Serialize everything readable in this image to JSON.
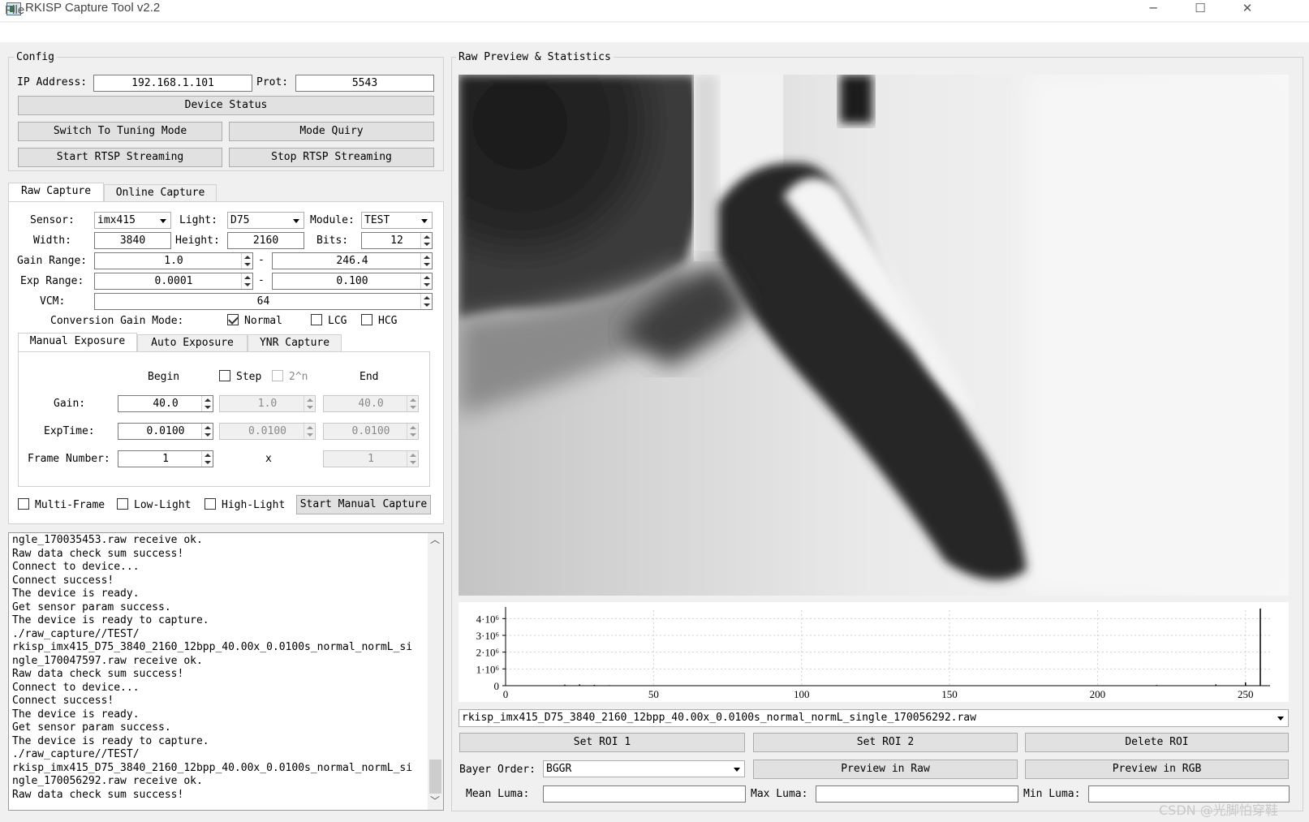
{
  "window": {
    "title": "RKISP Capture Tool v2.2",
    "minimize": "─",
    "maximize": "☐",
    "close": "✕"
  },
  "menu": {
    "file": "File"
  },
  "config": {
    "title": "Config",
    "ip_label": "IP Address:",
    "ip_value": "192.168.1.101",
    "port_label": "Prot:",
    "port_value": "5543",
    "device_status": "Device Status",
    "switch_tuning": "Switch To Tuning Mode",
    "mode_query": "Mode Quiry",
    "start_rtsp": "Start RTSP Streaming",
    "stop_rtsp": "Stop RTSP Streaming"
  },
  "capture_tabs": [
    "Raw Capture",
    "Online Capture"
  ],
  "raw": {
    "sensor_label": "Sensor:",
    "sensor_value": "imx415",
    "light_label": "Light:",
    "light_value": "D75",
    "module_label": "Module:",
    "module_value": "TEST",
    "width_label": "Width:",
    "width_value": "3840",
    "height_label": "Height:",
    "height_value": "2160",
    "bits_label": "Bits:",
    "bits_value": "12",
    "gain_range_label": "Gain Range:",
    "gain_min": "1.0",
    "gain_max": "246.4",
    "exp_range_label": "Exp Range:",
    "exp_min": "0.0001",
    "exp_max": "0.100",
    "dash": "-",
    "vcm_label": "VCM:",
    "vcm_value": "64",
    "cg_mode_label": "Conversion Gain Mode:",
    "cg_normal": "Normal",
    "cg_normal_checked": true,
    "cg_lcg": "LCG",
    "cg_hcg": "HCG"
  },
  "exposure_tabs": [
    "Manual Exposure",
    "Auto Exposure",
    "YNR Capture"
  ],
  "manual": {
    "begin": "Begin",
    "step": "Step",
    "pow2": "2^n",
    "end": "End",
    "gain_label": "Gain:",
    "gain_begin": "40.0",
    "gain_step": "1.0",
    "gain_end": "40.0",
    "exptime_label": "ExpTime:",
    "exp_begin": "0.0100",
    "exp_step": "0.0100",
    "exp_end": "0.0100",
    "frame_label": "Frame Number:",
    "frame_begin": "1",
    "x": "x",
    "frame_end": "1"
  },
  "options": {
    "multi_frame": "Multi-Frame",
    "low_light": "Low-Light",
    "high_light": "High-Light",
    "start_manual": "Start Manual Capture"
  },
  "log_lines": [
    "ngle_170035453.raw receive ok.",
    "Raw data check sum success!",
    "Connect to device...",
    "Connect success!",
    "The device is ready.",
    "Get sensor param success.",
    "The device is ready to capture.",
    "./raw_capture//TEST/",
    "rkisp_imx415_D75_3840_2160_12bpp_40.00x_0.0100s_normal_normL_si",
    "ngle_170047597.raw receive ok.",
    "Raw data check sum success!",
    "Connect to device...",
    "Connect success!",
    "The device is ready.",
    "Get sensor param success.",
    "The device is ready to capture.",
    "./raw_capture//TEST/",
    "rkisp_imx415_D75_3840_2160_12bpp_40.00x_0.0100s_normal_normL_si",
    "ngle_170056292.raw receive ok.",
    "Raw data check sum success!"
  ],
  "preview": {
    "title": "Raw Preview & Statistics",
    "file_value": "rkisp_imx415_D75_3840_2160_12bpp_40.00x_0.0100s_normal_normL_single_170056292.raw",
    "set_roi1": "Set ROI 1",
    "set_roi2": "Set ROI 2",
    "delete_roi": "Delete ROI",
    "bayer_label": "Bayer Order:",
    "bayer_value": "BGGR",
    "preview_raw": "Preview in Raw",
    "preview_rgb": "Preview in RGB",
    "mean_luma": "Mean Luma:",
    "max_luma": "Max Luma:",
    "min_luma": "Min Luma:"
  },
  "chart_data": {
    "type": "bar",
    "title": "",
    "xlabel": "",
    "ylabel": "",
    "xlim": [
      0,
      255
    ],
    "ylim": [
      0,
      4500000
    ],
    "x_ticks": [
      0,
      50,
      100,
      150,
      200,
      250
    ],
    "y_ticks": [
      "0",
      "1·10⁶",
      "2·10⁶",
      "3·10⁶",
      "4·10⁶"
    ],
    "grid": true,
    "x": [
      15,
      20,
      25,
      30,
      35,
      40,
      60,
      80,
      100,
      120,
      140,
      160,
      180,
      200,
      220,
      240,
      250,
      255
    ],
    "values": [
      20000,
      60000,
      80000,
      50000,
      30000,
      20000,
      15000,
      12000,
      12000,
      12000,
      15000,
      18000,
      20000,
      25000,
      40000,
      80000,
      200000,
      4600000
    ]
  },
  "watermark": "CSDN @光脚怕穿鞋"
}
